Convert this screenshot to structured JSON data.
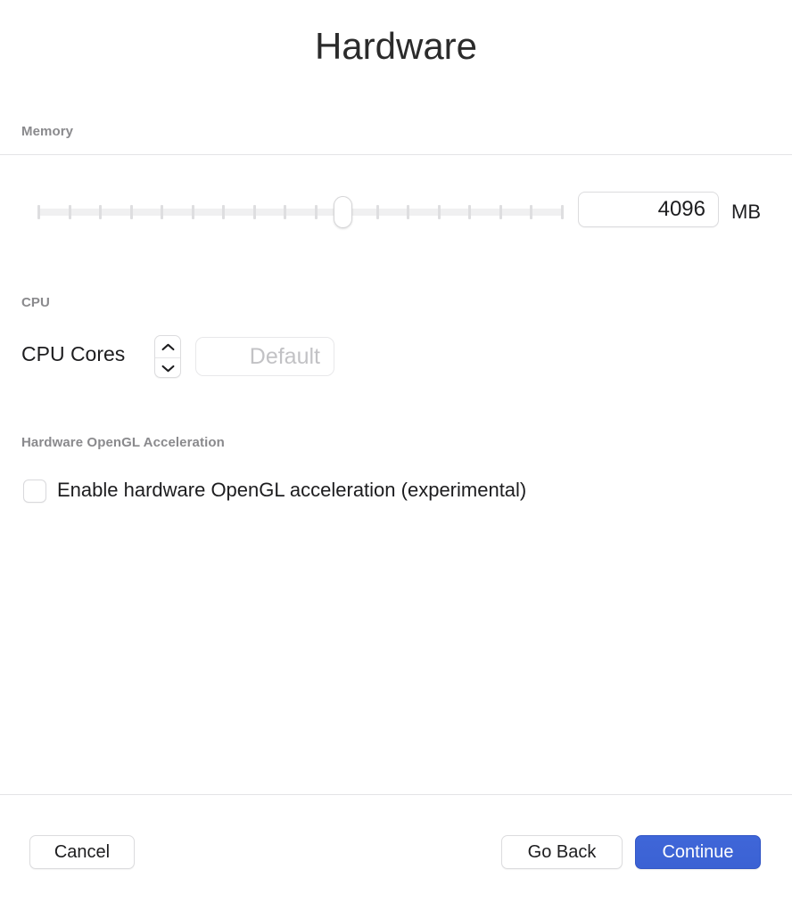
{
  "window": {
    "title": "Hardware"
  },
  "sections": {
    "memory": {
      "header": "Memory",
      "value": "4096",
      "unit": "MB",
      "slider": {
        "tick_count": 18,
        "thumb_position_percent": 58,
        "min": 0,
        "max": 100
      }
    },
    "cpu": {
      "header": "CPU",
      "cores_label": "CPU Cores",
      "cores_placeholder": "Default",
      "cores_value": "",
      "stepper_up_icon": "chevron-up-icon",
      "stepper_down_icon": "chevron-down-icon"
    },
    "opengl": {
      "header": "Hardware OpenGL Acceleration",
      "checkbox_label": "Enable hardware OpenGL acceleration (experimental)",
      "checked": false
    }
  },
  "footer": {
    "cancel_label": "Cancel",
    "go_back_label": "Go Back",
    "continue_label": "Continue"
  },
  "colors": {
    "primary_button": "#3b62d4",
    "primary_button_gradient_end": "#3f66d8",
    "title_text": "#2b2b2b",
    "section_header_text": "#8a8a8d",
    "divider": "#e4e4e6",
    "placeholder_text": "#c2c2c5",
    "slider_track": "#f0f0f1",
    "slider_tick": "#dedee0"
  }
}
